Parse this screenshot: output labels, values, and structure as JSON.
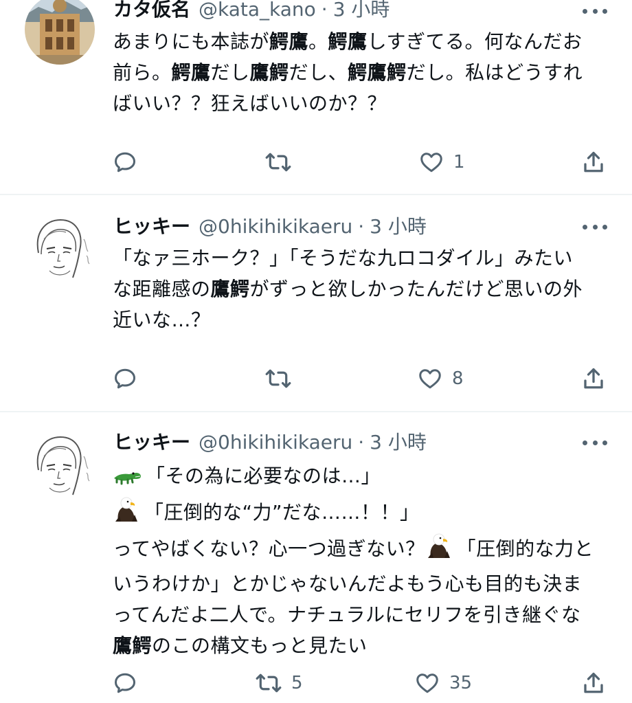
{
  "tweets": [
    {
      "name": "カタ仮名",
      "handle": "@kata_kano",
      "sep": "·",
      "time": "3 小時",
      "lines": [
        [
          {
            "t": "あまりにも本誌が"
          },
          {
            "t": "鰐鷹",
            "b": true
          },
          {
            "t": "。"
          },
          {
            "t": "鰐鷹",
            "b": true
          },
          {
            "t": "しすぎてる。何なんだお"
          }
        ],
        [
          {
            "t": "前ら。"
          },
          {
            "t": "鰐鷹",
            "b": true
          },
          {
            "t": "だし"
          },
          {
            "t": "鷹鰐",
            "b": true
          },
          {
            "t": "だし、"
          },
          {
            "t": "鰐鷹鰐",
            "b": true
          },
          {
            "t": "だし。私はどうすれ"
          }
        ],
        [
          {
            "t": "ばいい？？狂えばいいのか？？"
          }
        ]
      ],
      "actions": {
        "reply": "",
        "retweet": "",
        "like": "1",
        "share": ""
      }
    },
    {
      "name": "ヒッキー",
      "handle": "@0hikihikikaeru",
      "sep": "·",
      "time": "3 小時",
      "lines": [
        [
          {
            "t": "「なァ三ホーク？」「そうだな九ロコダイル」みたい"
          }
        ],
        [
          {
            "t": "な距離感の"
          },
          {
            "t": "鷹鰐",
            "b": true
          },
          {
            "t": "がずっと欲しかったんだけど思いの外"
          }
        ],
        [
          {
            "t": "近いな…？"
          }
        ]
      ],
      "actions": {
        "reply": "",
        "retweet": "",
        "like": "8",
        "share": ""
      }
    },
    {
      "name": "ヒッキー",
      "handle": "@0hikihikikaeru",
      "sep": "·",
      "time": "3 小時",
      "lines": [
        [
          {
            "e": "crocodile"
          },
          {
            "t": "「その為に必要なのは…」"
          }
        ],
        [
          {
            "e": "eagle"
          },
          {
            "t": "「圧倒的な“力”だな……！！」"
          }
        ],
        [
          {
            "t": "ってやばくない？心一つ過ぎない？"
          },
          {
            "e": "eagle"
          },
          {
            "t": "「圧倒的な力と"
          }
        ],
        [
          {
            "t": "いうわけか」とかじゃないんだよもう心も目的も決ま"
          }
        ],
        [
          {
            "t": "ってんだよ二人で。ナチュラルにセリフを引き継ぐな"
          }
        ],
        [
          {
            "t": "鷹鰐",
            "b": true
          },
          {
            "t": "のこの構文もっと見たい"
          }
        ]
      ],
      "actions": {
        "reply": "",
        "retweet": "5",
        "like": "35",
        "share": ""
      }
    }
  ],
  "icons": {
    "reply": "reply-icon",
    "retweet": "retweet-icon",
    "like": "heart-icon",
    "share": "share-icon",
    "more": "more-icon"
  },
  "colors": {
    "text": "#0f1419",
    "secondary": "#536471",
    "divider": "#eff3f4"
  }
}
